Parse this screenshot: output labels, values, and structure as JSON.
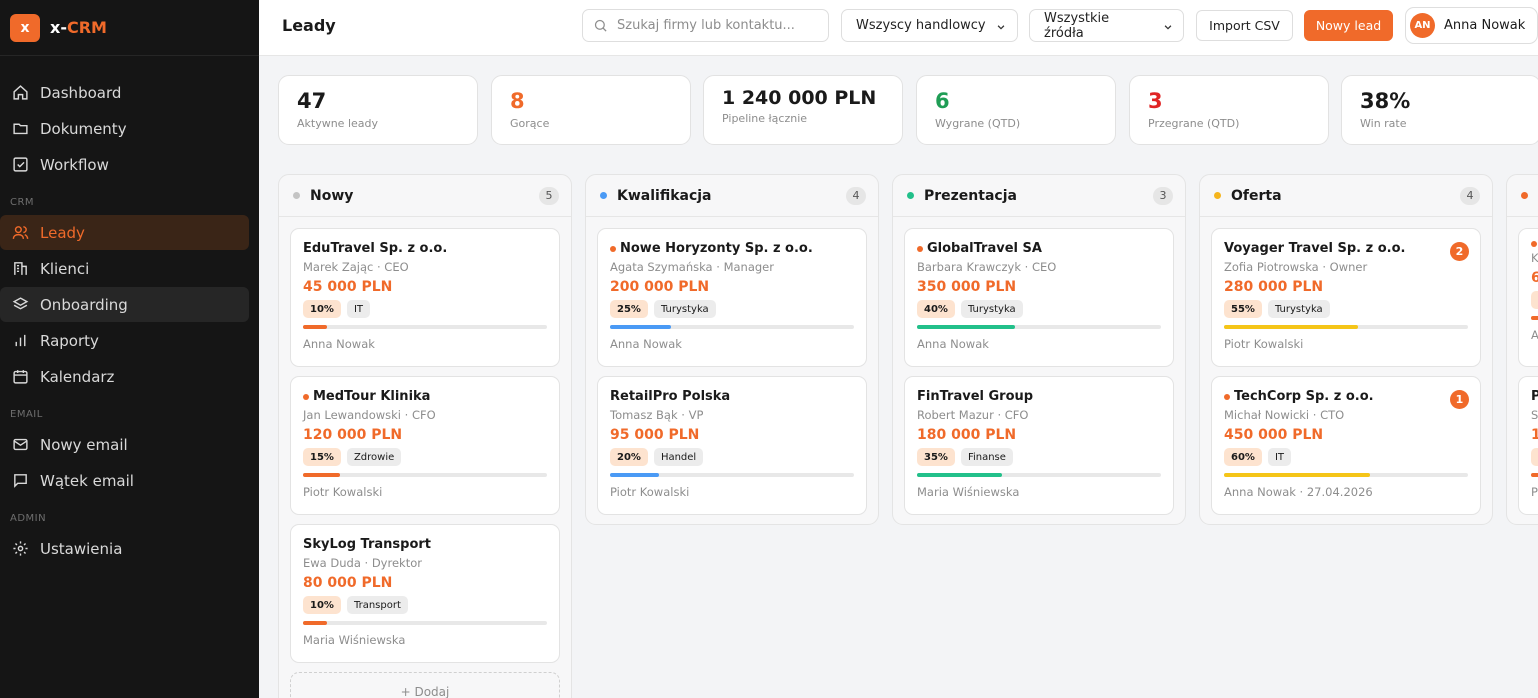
{
  "app": {
    "logo_letter": "x",
    "name_prefix": "x-",
    "name_suffix": "CRM"
  },
  "sidebar": {
    "items_main": [
      {
        "label": "Dashboard",
        "icon": "home-icon"
      },
      {
        "label": "Dokumenty",
        "icon": "folder-icon"
      },
      {
        "label": "Workflow",
        "icon": "checkbox-icon"
      }
    ],
    "section_crm": "CRM",
    "items_crm": [
      {
        "label": "Leady",
        "icon": "users-icon"
      },
      {
        "label": "Klienci",
        "icon": "building-icon"
      },
      {
        "label": "Onboarding",
        "icon": "layers-icon"
      },
      {
        "label": "Raporty",
        "icon": "bar-chart-icon"
      },
      {
        "label": "Kalendarz",
        "icon": "calendar-icon"
      }
    ],
    "section_email": "EMAIL",
    "items_email": [
      {
        "label": "Nowy email",
        "icon": "mail-icon"
      },
      {
        "label": "Wątek email",
        "icon": "chat-icon"
      }
    ],
    "section_admin": "ADMIN",
    "items_admin": [
      {
        "label": "Ustawienia",
        "icon": "gear-icon"
      }
    ]
  },
  "header": {
    "title": "Leady",
    "search_placeholder": "Szukaj firmy lub kontaktu...",
    "filter_sales": "Wszyscy handlowcy",
    "filter_source": "Wszystkie źródła",
    "import_label": "Import CSV",
    "new_lead_label": "Nowy lead",
    "user_initials": "AN",
    "user_name": "Anna Nowak"
  },
  "stats": [
    {
      "value": "47",
      "label": "Aktywne leady",
      "color": "#1a1a1a"
    },
    {
      "value": "8",
      "label": "Gorące",
      "color": "#f06a2a"
    },
    {
      "value": "1 240 000 PLN",
      "label": "Pipeline łącznie",
      "color": "#1a1a1a"
    },
    {
      "value": "6",
      "label": "Wygrane (QTD)",
      "color": "#1f9d55"
    },
    {
      "value": "3",
      "label": "Przegrane (QTD)",
      "color": "#e02424"
    },
    {
      "value": "38%",
      "label": "Win rate",
      "color": "#1a1a1a"
    }
  ],
  "columns": [
    {
      "title": "Nowy",
      "count": "5",
      "dot_color": "#c4c4c4",
      "bar_color": "#f06a2a",
      "add_label": "+ Dodaj",
      "cards": [
        {
          "company": "EduTravel Sp. z o.o.",
          "hot": false,
          "contact": "Marek Zając · CEO",
          "value": "45 000 PLN",
          "probability": "10%",
          "progress": 0.1,
          "category": "IT",
          "owner": "Anna Nowak",
          "badge": ""
        },
        {
          "company": "MedTour Klinika",
          "hot": true,
          "contact": "Jan Lewandowski · CFO",
          "value": "120 000 PLN",
          "probability": "15%",
          "progress": 0.15,
          "category": "Zdrowie",
          "owner": "Piotr Kowalski",
          "badge": ""
        },
        {
          "company": "SkyLog Transport",
          "hot": false,
          "contact": "Ewa Duda · Dyrektor",
          "value": "80 000 PLN",
          "probability": "10%",
          "progress": 0.1,
          "category": "Transport",
          "owner": "Maria Wiśniewska",
          "badge": ""
        }
      ]
    },
    {
      "title": "Kwalifikacja",
      "count": "4",
      "dot_color": "#4a9af5",
      "bar_color": "#4a9af5",
      "cards": [
        {
          "company": "Nowe Horyzonty Sp. z o.o.",
          "hot": true,
          "contact": "Agata Szymańska · Manager",
          "value": "200 000 PLN",
          "probability": "25%",
          "progress": 0.25,
          "category": "Turystyka",
          "owner": "Anna Nowak",
          "badge": ""
        },
        {
          "company": "RetailPro Polska",
          "hot": false,
          "contact": "Tomasz Bąk · VP",
          "value": "95 000 PLN",
          "probability": "20%",
          "progress": 0.2,
          "category": "Handel",
          "owner": "Piotr Kowalski",
          "badge": ""
        }
      ]
    },
    {
      "title": "Prezentacja",
      "count": "3",
      "dot_color": "#22c08a",
      "bar_color": "#22c08a",
      "cards": [
        {
          "company": "GlobalTravel SA",
          "hot": true,
          "contact": "Barbara Krawczyk · CEO",
          "value": "350 000 PLN",
          "probability": "40%",
          "progress": 0.4,
          "category": "Turystyka",
          "owner": "Anna Nowak",
          "badge": ""
        },
        {
          "company": "FinTravel Group",
          "hot": false,
          "contact": "Robert Mazur · CFO",
          "value": "180 000 PLN",
          "probability": "35%",
          "progress": 0.35,
          "category": "Finanse",
          "owner": "Maria Wiśniewska",
          "badge": ""
        }
      ]
    },
    {
      "title": "Oferta",
      "count": "4",
      "dot_color": "#f5b51d",
      "bar_color": "#f5c518",
      "cards": [
        {
          "company": "Voyager Travel Sp. z o.o.",
          "hot": false,
          "contact": "Zofia Piotrowska · Owner",
          "value": "280 000 PLN",
          "probability": "55%",
          "progress": 0.55,
          "category": "Turystyka",
          "owner": "Piotr Kowalski",
          "badge": "2"
        },
        {
          "company": "TechCorp Sp. z o.o.",
          "hot": true,
          "contact": "Michał Nowicki · CTO",
          "value": "450 000 PLN",
          "probability": "60%",
          "progress": 0.6,
          "category": "IT",
          "owner": "Anna Nowak · 27.04.2026",
          "badge": "1"
        }
      ]
    }
  ],
  "partial_column": {
    "dot_color": "#f06a2a",
    "cards": [
      {
        "line1": "K",
        "line2": "6",
        "line3": "A"
      },
      {
        "line0": "P",
        "line1": "S",
        "line2": "1",
        "line3": "P"
      }
    ]
  }
}
